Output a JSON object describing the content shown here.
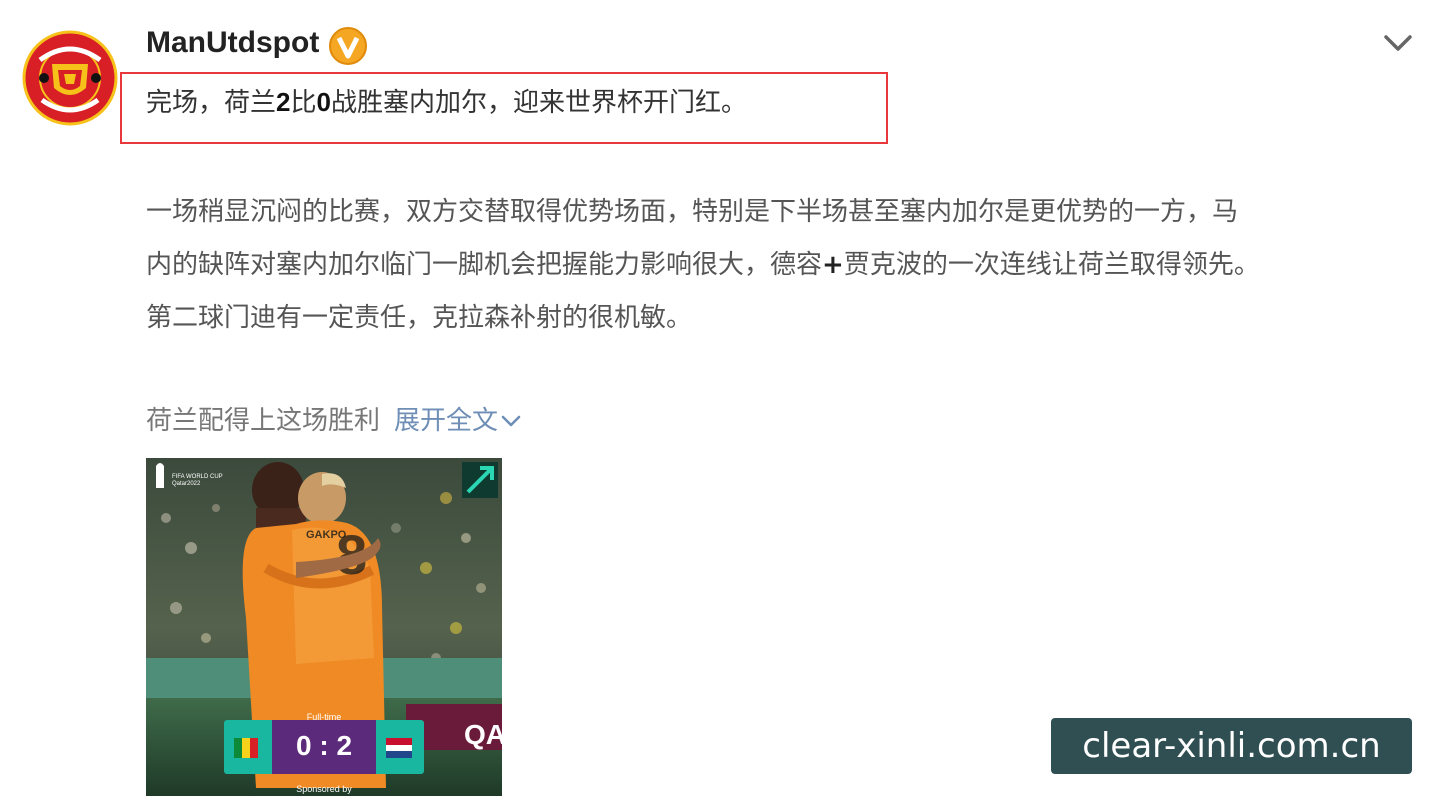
{
  "post": {
    "username": "ManUtdspot",
    "headline": {
      "part1": "完场，荷兰",
      "score_a": "2",
      "part2": "比",
      "score_b": "0",
      "part3": "战胜塞内加尔，迎来世界杯开门红。"
    },
    "body_lines": {
      "line1": "一场稍显沉闷的比赛，双方交替取得优势场面，特别是下半场甚至塞内加尔是更优势的一方，马",
      "line2_a": "内的缺阵对塞内加尔临门一脚机会把握能力影响很大，德容",
      "line2_plus": "+",
      "line2_b": "贾克波的一次连线让荷兰取得领先。",
      "line3": "第二球门迪有一定责任，克拉森补射的很机敏。"
    },
    "last_line": "荷兰配得上这场胜利",
    "expand_label": "展开全文"
  },
  "photo": {
    "fulltime_label": "Full-time",
    "score": "0 : 2",
    "sponsored_label": "Sponsored by",
    "wc_logo_text": "FIFA WORLD CUP\nQatar2022",
    "jersey_name": "GAKPO",
    "ad_board_text": "QAT"
  },
  "watermark": "clear-xinli.com.cn",
  "colors": {
    "highlight_border": "#e8383b",
    "link": "#6e8eb5",
    "verify_badge": "#f5a623",
    "watermark_bg": "#2f4f52",
    "netherlands_orange": "#f08a24",
    "score_bar": "#5b2a7a",
    "score_flag_bg": "#19b6a0"
  },
  "icons": {
    "avatar": "manchester-united-crest-icon",
    "verify": "verified-v-badge-icon",
    "collapse": "chevron-down-icon",
    "expand": "chevron-down-icon"
  }
}
